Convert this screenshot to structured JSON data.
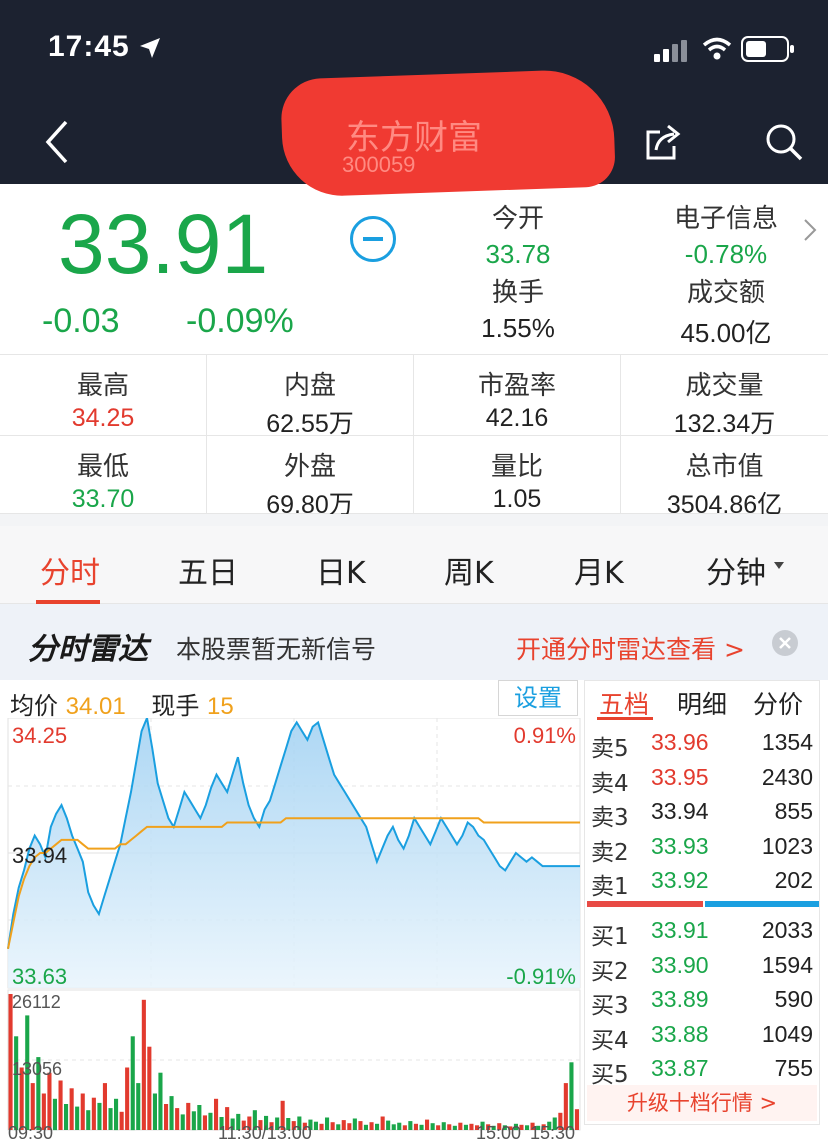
{
  "status_bar": {
    "time": "17:45"
  },
  "nav": {
    "title": "东方财富",
    "subtitle": "300059"
  },
  "quote": {
    "price": "33.91",
    "change": "-0.03",
    "change_pct": "-0.09%",
    "open_label": "今开",
    "open": "33.78",
    "sector_label": "电子信息",
    "sector_change": "-0.78%",
    "turnover_label": "换手",
    "turnover": "1.55%",
    "amount_label": "成交额",
    "amount": "45.00亿"
  },
  "stats": [
    {
      "label": "最高",
      "value": "34.25",
      "color": "#e23a2e"
    },
    {
      "label": "内盘",
      "value": "62.55万"
    },
    {
      "label": "市盈率",
      "value": "42.16"
    },
    {
      "label": "成交量",
      "value": "132.34万"
    },
    {
      "label": "最低",
      "value": "33.70",
      "color": "#1aa64a"
    },
    {
      "label": "外盘",
      "value": "69.80万"
    },
    {
      "label": "量比",
      "value": "1.05"
    },
    {
      "label": "总市值",
      "value": "3504.86亿"
    }
  ],
  "tabs": [
    "分时",
    "五日",
    "日K",
    "周K",
    "月K",
    "分钟"
  ],
  "radar": {
    "logo": "分时雷达",
    "message": "本股票暂无新信号",
    "link": "开通分时雷达查看 >"
  },
  "chart_head": {
    "avg_label": "均价",
    "avg_value": "34.01",
    "hand_label": "现手",
    "hand_value": "15",
    "settings": "设置"
  },
  "chart_data": {
    "type": "line",
    "y_labels": {
      "top": "34.25",
      "mid": "33.94",
      "bottom": "33.63",
      "top_pct": "0.91%",
      "bottom_pct": "-0.91%"
    },
    "ylim": [
      33.63,
      34.25
    ],
    "ref_price": 33.94,
    "x_labels": [
      "09:30",
      "11:30/13:00",
      "15:00",
      "15:30"
    ],
    "price": [
      33.72,
      33.8,
      33.86,
      33.9,
      33.95,
      33.98,
      33.96,
      33.93,
      34.0,
      34.03,
      34.05,
      34.02,
      33.98,
      33.95,
      33.92,
      33.85,
      33.82,
      33.8,
      33.84,
      33.88,
      33.92,
      33.96,
      34.02,
      34.08,
      34.15,
      34.22,
      34.25,
      34.18,
      34.1,
      34.06,
      34.02,
      34.0,
      34.04,
      34.08,
      34.06,
      34.04,
      34.02,
      34.05,
      34.09,
      34.12,
      34.1,
      34.08,
      34.12,
      34.16,
      34.1,
      34.05,
      34.02,
      34.0,
      34.04,
      34.06,
      34.1,
      34.14,
      34.18,
      34.22,
      34.24,
      34.22,
      34.2,
      34.23,
      34.24,
      34.2,
      34.16,
      34.12,
      34.1,
      34.08,
      34.06,
      34.04,
      34.02,
      34.0,
      33.96,
      33.92,
      33.95,
      33.98,
      34.0,
      33.97,
      33.95,
      33.98,
      34.02,
      34.0,
      33.98,
      33.96,
      33.99,
      34.02,
      34.0,
      33.98,
      33.96,
      33.98,
      34.01,
      34.0,
      33.98,
      33.97,
      33.95,
      33.93,
      33.91,
      33.9,
      33.92,
      33.94,
      33.93,
      33.92,
      33.93,
      33.92,
      33.91,
      33.91,
      33.91,
      33.91,
      33.91,
      33.91,
      33.91,
      33.91
    ],
    "avg": [
      33.72,
      33.78,
      33.84,
      33.88,
      33.91,
      33.93,
      33.94,
      33.94,
      33.95,
      33.96,
      33.97,
      33.97,
      33.97,
      33.97,
      33.96,
      33.95,
      33.95,
      33.95,
      33.95,
      33.95,
      33.95,
      33.96,
      33.96,
      33.97,
      33.98,
      33.99,
      34.0,
      34.0,
      34.0,
      34.0,
      34.0,
      34.0,
      34.0,
      34.0,
      34.0,
      34.0,
      34.0,
      34.0,
      34.0,
      34.0,
      34.0,
      34.01,
      34.01,
      34.01,
      34.01,
      34.01,
      34.01,
      34.01,
      34.01,
      34.01,
      34.01,
      34.01,
      34.02,
      34.02,
      34.02,
      34.02,
      34.02,
      34.02,
      34.02,
      34.02,
      34.02,
      34.02,
      34.02,
      34.02,
      34.02,
      34.02,
      34.02,
      34.02,
      34.02,
      34.02,
      34.02,
      34.02,
      34.02,
      34.02,
      34.02,
      34.02,
      34.02,
      34.02,
      34.02,
      34.02,
      34.02,
      34.02,
      34.02,
      34.02,
      34.02,
      34.02,
      34.02,
      34.02,
      34.02,
      34.01,
      34.01,
      34.01,
      34.01,
      34.01,
      34.01,
      34.01,
      34.01,
      34.01,
      34.01,
      34.01,
      34.01,
      34.01,
      34.01,
      34.01,
      34.01,
      34.01,
      34.01,
      34.01
    ],
    "volume_labels": {
      "max": "26112",
      "mid": "13056"
    },
    "volume_max": 26112,
    "volumes": [
      26112,
      18000,
      12000,
      22000,
      9000,
      14000,
      7000,
      11000,
      6000,
      9500,
      5000,
      8000,
      4500,
      7000,
      3800,
      6200,
      5200,
      9000,
      4200,
      6000,
      3500,
      12000,
      18000,
      9000,
      25000,
      16000,
      7000,
      11000,
      5000,
      6500,
      4200,
      3000,
      5200,
      3600,
      4800,
      2800,
      3300,
      6000,
      2500,
      4400,
      2200,
      3100,
      1800,
      2600,
      3800,
      1900,
      2700,
      1500,
      2400,
      5600,
      2300,
      1700,
      2600,
      1400,
      2000,
      1600,
      1200,
      2400,
      1500,
      1100,
      1900,
      1300,
      2200,
      1700,
      1000,
      1500,
      1200,
      2600,
      1800,
      1100,
      1400,
      900,
      1700,
      1200,
      1000,
      2000,
      1300,
      900,
      1500,
      1100,
      800,
      1400,
      1000,
      1200,
      900,
      1600,
      1100,
      800,
      1300,
      900,
      700,
      1200,
      1000,
      900,
      1400,
      800,
      1100,
      1600,
      2400,
      3300,
      9000,
      13000,
      4000
    ],
    "volume_colors": "rgrgrgrrgrgrgrgrgrggrrggrrggrgrgrggrgrgrggrrgrgrgrgrgrggrgrgrrgrgrgrgggrgrgrgrgrgrgrrgrgrgrgrgrgrggrrgrg"
  },
  "book": {
    "tabs": [
      "五档",
      "明细",
      "分价"
    ],
    "asks": [
      {
        "label": "卖5",
        "price": "33.96",
        "vol": "1354",
        "color": "#e23a2e"
      },
      {
        "label": "卖4",
        "price": "33.95",
        "vol": "2430",
        "color": "#e23a2e"
      },
      {
        "label": "卖3",
        "price": "33.94",
        "vol": "855",
        "color": "#222222"
      },
      {
        "label": "卖2",
        "price": "33.93",
        "vol": "1023",
        "color": "#1aa64a"
      },
      {
        "label": "卖1",
        "price": "33.92",
        "vol": "202",
        "color": "#1aa64a"
      }
    ],
    "bids": [
      {
        "label": "买1",
        "price": "33.91",
        "vol": "2033",
        "color": "#1aa64a"
      },
      {
        "label": "买2",
        "price": "33.90",
        "vol": "1594",
        "color": "#1aa64a"
      },
      {
        "label": "买3",
        "price": "33.89",
        "vol": "590",
        "color": "#1aa64a"
      },
      {
        "label": "买4",
        "price": "33.88",
        "vol": "1049",
        "color": "#1aa64a"
      },
      {
        "label": "买5",
        "price": "33.87",
        "vol": "755",
        "color": "#1aa64a"
      }
    ],
    "upgrade": "升级十档行情 >"
  },
  "colors": {
    "up": "#e23a2e",
    "down": "#1aa64a",
    "line": "#1a9fe0",
    "avg": "#f0a11c"
  }
}
